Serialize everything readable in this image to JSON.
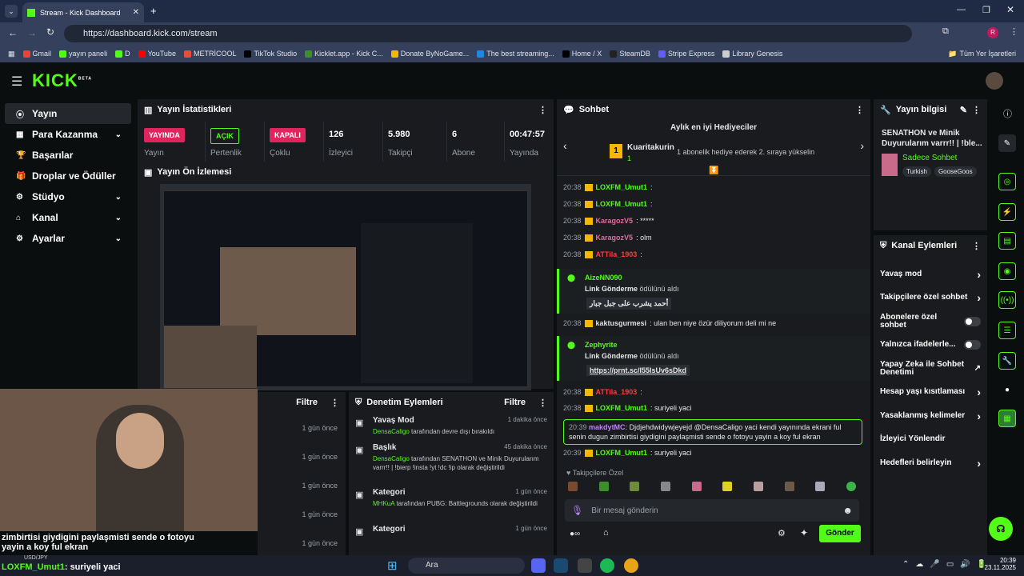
{
  "browser": {
    "tab_title": "Stream - Kick Dashboard",
    "url": "https://dashboard.kick.com/stream",
    "all_bookmarks": "Tüm Yer İşaretleri",
    "bookmarks": [
      "Gmail",
      "yayın paneli",
      "D",
      "YouTube",
      "METRİCOOL",
      "TikTok Studio",
      "Kicklet.app - Kick C...",
      "Donate ByNoGame...",
      "The best streaming...",
      "Home / X",
      "SteamDB",
      "Stripe Express",
      "Library Genesis"
    ],
    "profile_initial": "R"
  },
  "app": {
    "logo": "KICK",
    "beta": "BETA"
  },
  "sidebar": {
    "items": [
      {
        "label": "Yayın",
        "icon": "broadcast-icon"
      },
      {
        "label": "Para Kazanma",
        "icon": "money-icon"
      },
      {
        "label": "Başarılar",
        "icon": "trophy-icon"
      },
      {
        "label": "Droplar ve Ödüller",
        "icon": "gift-icon"
      },
      {
        "label": "Stüdyo",
        "icon": "gear-icon"
      },
      {
        "label": "Kanal",
        "icon": "home-icon"
      },
      {
        "label": "Ayarlar",
        "icon": "settings-icon"
      }
    ]
  },
  "stats": {
    "title": "Yayın İstatistikleri",
    "items": [
      {
        "badge": "YAYINDA",
        "label": "Yayın"
      },
      {
        "badge": "AÇIK",
        "label": "Pertenlik"
      },
      {
        "badge": "KAPALI",
        "label": "Çoklu"
      },
      {
        "value": "126",
        "label": "İzleyici"
      },
      {
        "value": "5.980",
        "label": "Takipçi"
      },
      {
        "value": "6",
        "label": "Abone"
      },
      {
        "value": "00:47:57",
        "label": "Yayında"
      }
    ]
  },
  "preview": {
    "title": "Yayın Ön İzlemesi"
  },
  "overlay": {
    "line1": "zimbirtisi giydigini paylaşmisti sende o fotoyu",
    "line2": "yayin a koy ful ekran",
    "user": "LOXFM_Umut1",
    "msg": ": suriyeli yaci",
    "ticker": "USD/JPY"
  },
  "activity": {
    "filter": "Filtre",
    "times": [
      "1 gün önce",
      "1 gün önce",
      "1 gün önce",
      "1 gün önce",
      "1 gün önce"
    ]
  },
  "moderation": {
    "title": "Denetim Eylemleri",
    "filter": "Filtre",
    "items": [
      {
        "title": "Yavaş Mod",
        "time": "1 dakika önce",
        "user": "DensaCaligo",
        "text": "tarafından devre dışı bırakıldı"
      },
      {
        "title": "Başlık",
        "time": "45 dakika önce",
        "user": "DensaCaligo",
        "text": "tarafından SENATHON ve Minik Duyurularım varrr!! | !bierp !insta !yt !dc !ip olarak değiştirildi"
      },
      {
        "title": "Kategori",
        "time": "1 gün önce",
        "user": "MHKuA",
        "text": "tarafından PUBG: Battlegrounds olarak değiştirildi"
      },
      {
        "title": "Kategori",
        "time": "1 gün önce",
        "user": "",
        "text": ""
      }
    ]
  },
  "chat": {
    "title": "Sohbet",
    "gifters_title": "Aylık en iyi Hediyeciler",
    "top_gifter": "Kuaritakurin",
    "top_gifter_count": "1",
    "gifter_hint": "1 abonelik hediye ederek 2. sıraya yükselin",
    "messages": [
      {
        "time": "20:38",
        "user": "LOXFM_Umut1",
        "text": ":",
        "color": "#53fc18"
      },
      {
        "time": "20:38",
        "user": "LOXFM_Umut1",
        "text": ":",
        "color": "#53fc18"
      },
      {
        "time": "20:38",
        "user": "KaragozV5",
        "text": ": *****",
        "color": "#e06c9f"
      },
      {
        "time": "20:38",
        "user": "KaragozV5",
        "text": ": olm",
        "color": "#e06c9f"
      },
      {
        "time": "20:38",
        "user": "ATTila_1903",
        "text": ":",
        "color": "#ff3b3b"
      }
    ],
    "reward1": {
      "user": "AizeNN090",
      "label": "Link Gönderme",
      "suffix": "ödülünü aldı",
      "content": "أحمد يشرب على جبل جبار"
    },
    "msg2": {
      "time": "20:38",
      "user": "kaktusgurmesi",
      "text": ": ulan ben niye özür diliyorum deli mi ne"
    },
    "reward2": {
      "user": "Zephyrite",
      "label": "Link Gönderme",
      "suffix": "ödülünü aldı",
      "content": "https://prnt.sc/I55IsUv6sDkd"
    },
    "messages2": [
      {
        "time": "20:38",
        "user": "ATTila_1903",
        "text": ":",
        "color": "#ff3b3b"
      },
      {
        "time": "20:38",
        "user": "LOXFM_Umut1",
        "text": ": suriyeli yaci",
        "color": "#53fc18"
      }
    ],
    "highlight": {
      "time": "20:39",
      "user": "makdytMC",
      "text": ": Djdjehdwidywjeyejd @DensaCaligo yaci kendi yayınında ekrani ful senin dugun zimbirtisi giydigini paylaşmisti sende o fotoyu yayin a koy ful ekran"
    },
    "last": {
      "time": "20:39",
      "user": "LOXFM_Umut1",
      "text": ": suriyeli yaci"
    },
    "followers_label": "Takipçilere Özel",
    "input_placeholder": "Bir mesaj gönderin",
    "send": "Gönder"
  },
  "info": {
    "title": "Yayın bilgisi",
    "stream_title": "SENATHON ve Minik Duyurularım varrr!! | !ble...",
    "channel": "Sadece Sohbet",
    "tags": [
      "Turkish",
      "GooseGoos"
    ]
  },
  "actions": {
    "title": "Kanal Eylemleri",
    "items": [
      {
        "label": "Yavaş mod",
        "ctrl": "chev"
      },
      {
        "label": "Takipçilere özel sohbet",
        "ctrl": "chev"
      },
      {
        "label": "Abonelere özel sohbet",
        "ctrl": "toggle"
      },
      {
        "label": "Yalnızca ifadelerle...",
        "ctrl": "toggle"
      },
      {
        "label": "Yapay Zeka ile Sohbet Denetimi",
        "ctrl": "ext"
      },
      {
        "label": "Hesap yaşı kısıtlaması",
        "ctrl": "chev"
      },
      {
        "label": "Yasaklanmış kelimeler",
        "ctrl": "chev"
      },
      {
        "label": "İzleyici Yönlendir",
        "ctrl": "none"
      },
      {
        "label": "Hedefleri belirleyin",
        "ctrl": "chev"
      }
    ]
  },
  "taskbar": {
    "search": "Ara",
    "time": "20:39",
    "date": "23.11.2025"
  }
}
